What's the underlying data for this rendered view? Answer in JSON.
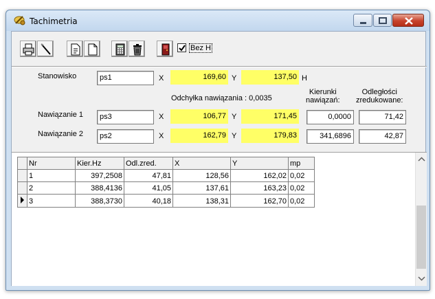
{
  "window": {
    "title": "Tachimetria"
  },
  "toolbar": {
    "buttons": [
      "print-icon",
      "edit-icon",
      "document-icon",
      "new-document-icon",
      "calculator-icon",
      "trash-icon",
      "exit-door-icon"
    ],
    "bez_h": {
      "label": "Bez H",
      "checked": true
    }
  },
  "form": {
    "stanowisko": {
      "label": "Stanowisko",
      "value": "ps1",
      "x_label": "X",
      "x": "169,60",
      "y_label": "Y",
      "y": "137,50",
      "h_label": "H"
    },
    "odchylka": "Odchyłka nawiązania : 0,0035",
    "kierunki_header": "Kierunki\nnawiązań:",
    "odleglosci_header": "Odległości\nzredukowane:",
    "nawiazanie1": {
      "label": "Nawiązanie 1",
      "value": "ps3",
      "x_label": "X",
      "x": "106,77",
      "y_label": "Y",
      "y": "171,45",
      "kierunek": "0,0000",
      "odleglosc": "71,42"
    },
    "nawiazanie2": {
      "label": "Nawiązanie 2",
      "value": "ps2",
      "x_label": "X",
      "x": "162,79",
      "y_label": "Y",
      "y": "179,83",
      "kierunek": "341,6896",
      "odleglosc": "42,87"
    }
  },
  "grid": {
    "columns": [
      "Nr",
      "Kier.Hz",
      "Odl.zred.",
      "X",
      "Y",
      "mp"
    ],
    "rows": [
      [
        "1",
        "397,2508",
        "47,81",
        "128,56",
        "162,02",
        "0,02"
      ],
      [
        "2",
        "388,4136",
        "41,05",
        "137,61",
        "163,23",
        "0,02"
      ],
      [
        "3",
        "388,3730",
        "40,18",
        "138,31",
        "162,70",
        "0,02"
      ]
    ],
    "current_row": 2
  },
  "colors": {
    "highlight": "#ffff66",
    "titlebar": "#c2d7ee",
    "close": "#c7432c"
  }
}
